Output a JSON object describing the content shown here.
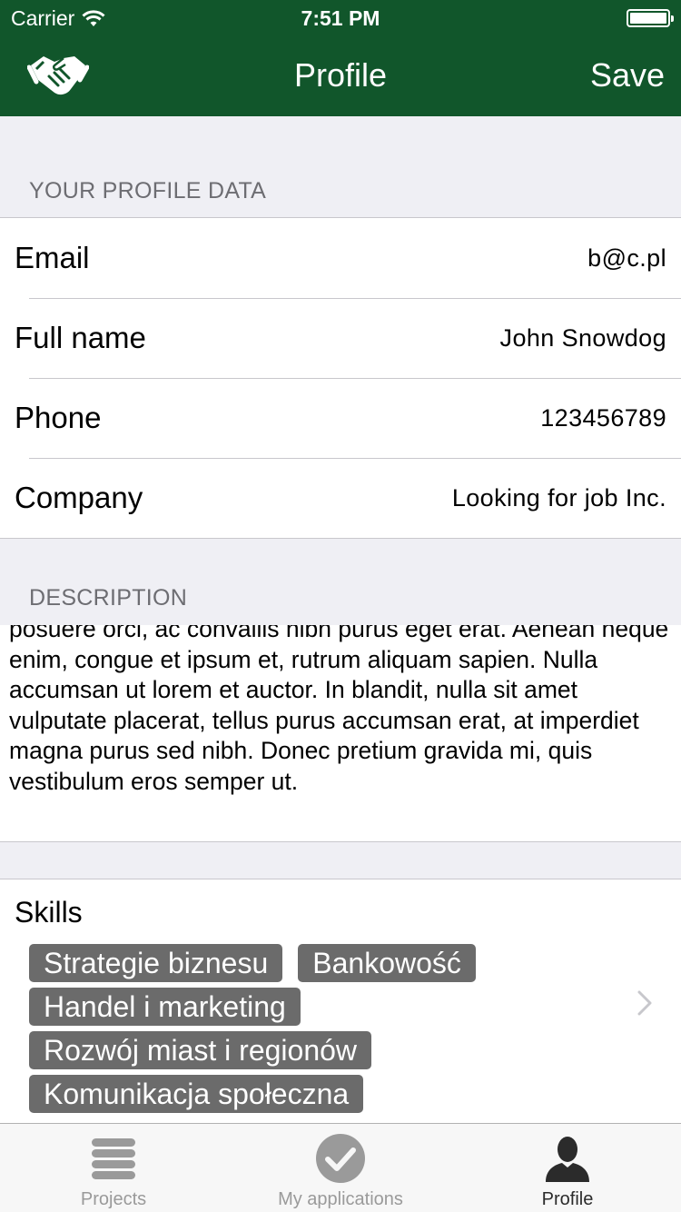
{
  "status_bar": {
    "carrier": "Carrier",
    "time": "7:51 PM"
  },
  "nav": {
    "title": "Profile",
    "save_label": "Save"
  },
  "profile_section": {
    "header": "YOUR PROFILE DATA",
    "rows": [
      {
        "label": "Email",
        "value": "b@c.pl"
      },
      {
        "label": "Full name",
        "value": "John Snowdog"
      },
      {
        "label": "Phone",
        "value": "123456789"
      },
      {
        "label": "Company",
        "value": "Looking for job Inc."
      }
    ]
  },
  "description": {
    "header": "DESCRIPTION",
    "text": "posuere orci, ac convallis nibh purus eget erat. Aenean neque enim, congue et ipsum et, rutrum aliquam sapien. Nulla accumsan ut lorem et auctor. In blandit, nulla sit amet vulputate placerat, tellus purus accumsan erat, at imperdiet magna purus sed nibh. Donec pretium gravida mi, quis vestibulum eros semper ut."
  },
  "skills": {
    "title": "Skills",
    "items": [
      "Strategie biznesu",
      "Bankowość",
      "Handel i marketing",
      "Rozwój miast i regionów",
      "Komunikacja społeczna"
    ]
  },
  "tabbar": {
    "tabs": [
      {
        "label": "Projects",
        "icon": "list-icon"
      },
      {
        "label": "My applications",
        "icon": "checkmark-circle-icon"
      },
      {
        "label": "Profile",
        "icon": "person-icon",
        "active": true
      }
    ]
  },
  "colors": {
    "brand": "#11562b",
    "chip": "#6b6b6b",
    "tab_inactive": "#9a9a9a",
    "tab_active": "#2b2b2b"
  }
}
